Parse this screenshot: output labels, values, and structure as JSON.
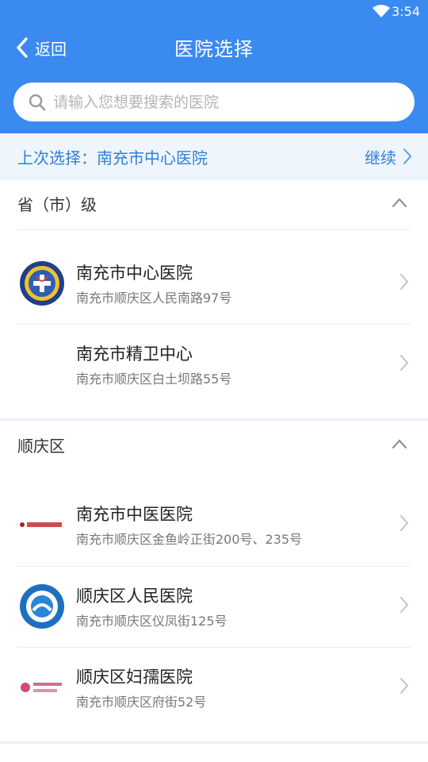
{
  "status": {
    "time": "3:54"
  },
  "nav": {
    "back_label": "返回",
    "title": "医院选择"
  },
  "search": {
    "placeholder": "请输入您想要搜索的医院"
  },
  "last_choice": {
    "label": "上次选择：南充市中心医院",
    "continue_label": "继续"
  },
  "sections": [
    {
      "title": "省（市）级",
      "hospitals": [
        {
          "name": "南充市中心医院",
          "address": "南充市顺庆区人民南路97号",
          "logo": "central-hospital-logo"
        },
        {
          "name": "南充市精卫中心",
          "address": "南充市顺庆区白土坝路55号",
          "logo": ""
        }
      ]
    },
    {
      "title": "顺庆区",
      "hospitals": [
        {
          "name": "南充市中医医院",
          "address": "南充市顺庆区金鱼岭正街200号、235号",
          "logo": "tcm-hospital-logo"
        },
        {
          "name": "顺庆区人民医院",
          "address": "南充市顺庆区仪凤街125号",
          "logo": "shunqing-peoples-hospital-logo"
        },
        {
          "name": "顺庆区妇孺医院",
          "address": "南充市顺庆区府街52号",
          "logo": "maternal-child-hospital-logo"
        }
      ]
    }
  ],
  "colors": {
    "primary": "#3a8af0",
    "accent_text": "#2f7fd9",
    "banner_bg": "#eef5fd"
  }
}
